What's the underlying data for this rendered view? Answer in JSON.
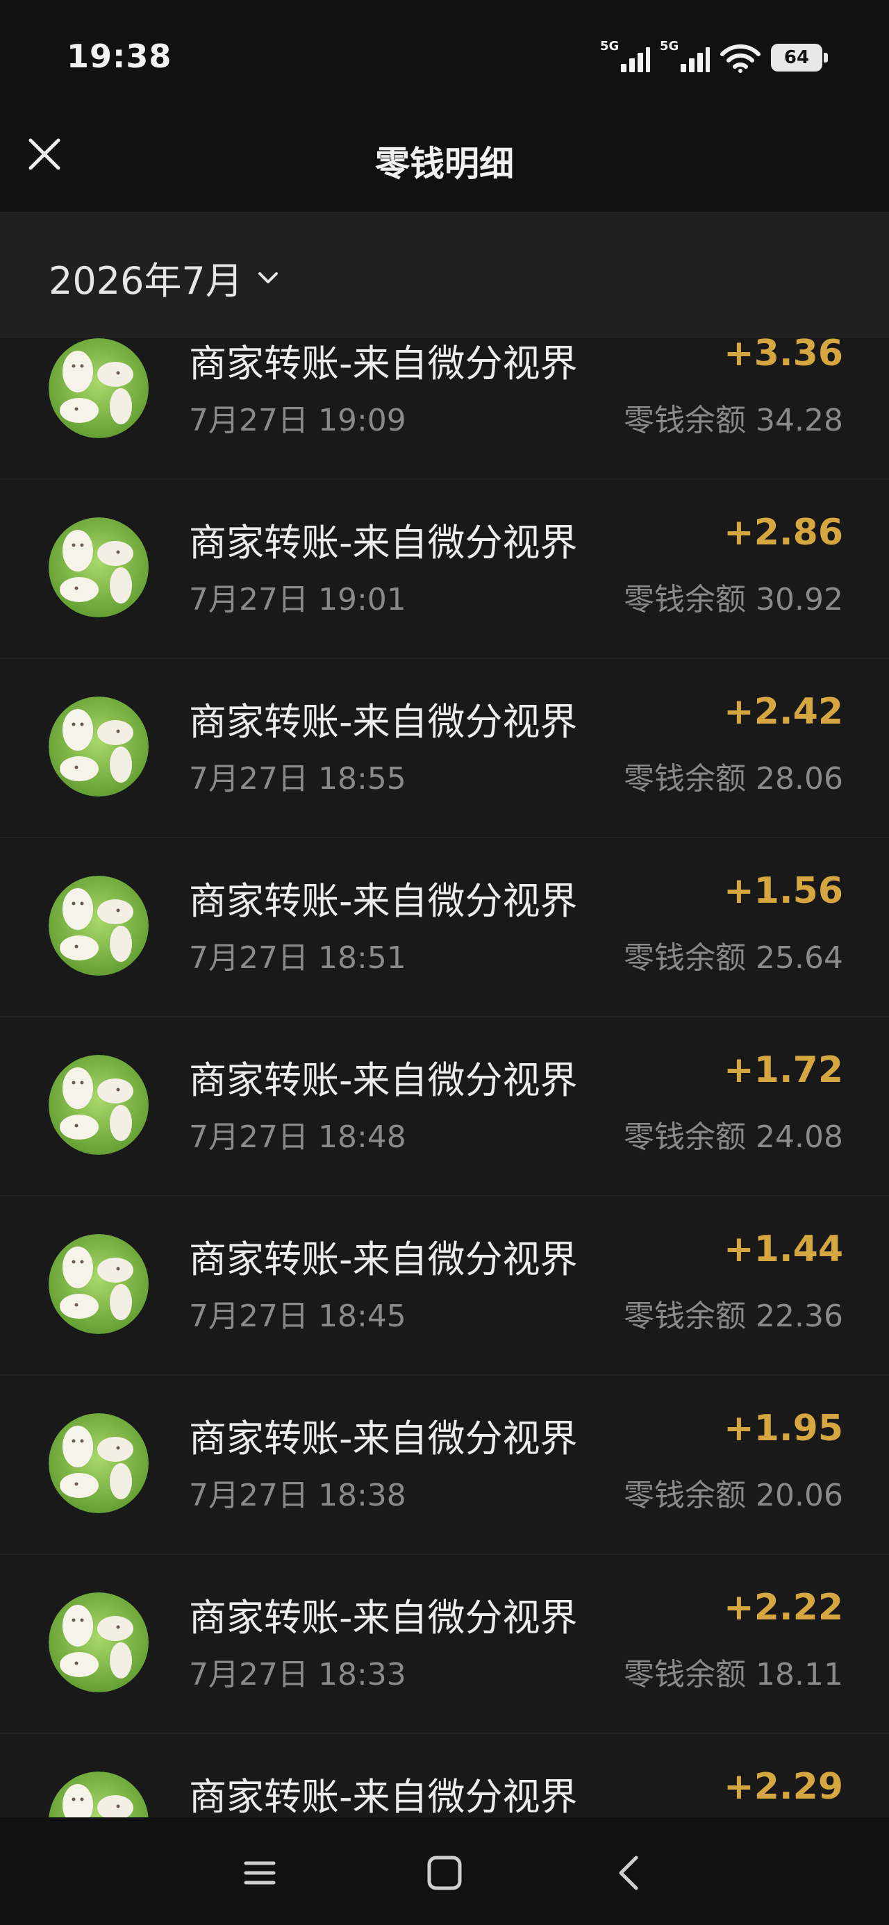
{
  "status_bar": {
    "time": "19:38",
    "network_1": "5G",
    "network_2": "5G",
    "battery": "64"
  },
  "header": {
    "title": "零钱明细"
  },
  "month_filter": {
    "label": "2026年7月"
  },
  "colors": {
    "background": "#191919",
    "amount": "#d6a640",
    "secondary_text": "#8a8a8a"
  },
  "icons": {
    "close": "close-icon",
    "chevron": "chevron-down-icon",
    "avatar": "sheep-avatar"
  },
  "transactions": [
    {
      "title": "商家转账-来自微分视界",
      "date": "7月27日 19:09",
      "amount": "+3.36",
      "balance": "零钱余额 34.28"
    },
    {
      "title": "商家转账-来自微分视界",
      "date": "7月27日 19:01",
      "amount": "+2.86",
      "balance": "零钱余额 30.92"
    },
    {
      "title": "商家转账-来自微分视界",
      "date": "7月27日 18:55",
      "amount": "+2.42",
      "balance": "零钱余额 28.06"
    },
    {
      "title": "商家转账-来自微分视界",
      "date": "7月27日 18:51",
      "amount": "+1.56",
      "balance": "零钱余额 25.64"
    },
    {
      "title": "商家转账-来自微分视界",
      "date": "7月27日 18:48",
      "amount": "+1.72",
      "balance": "零钱余额 24.08"
    },
    {
      "title": "商家转账-来自微分视界",
      "date": "7月27日 18:45",
      "amount": "+1.44",
      "balance": "零钱余额 22.36"
    },
    {
      "title": "商家转账-来自微分视界",
      "date": "7月27日 18:38",
      "amount": "+1.95",
      "balance": "零钱余额 20.06"
    },
    {
      "title": "商家转账-来自微分视界",
      "date": "7月27日 18:33",
      "amount": "+2.22",
      "balance": "零钱余额 18.11"
    },
    {
      "title": "商家转账-来自微分视界",
      "date": "",
      "amount": "+2.29",
      "balance": ""
    }
  ],
  "nav": {
    "menu": "menu-icon",
    "home": "home-icon",
    "back": "back-icon"
  }
}
